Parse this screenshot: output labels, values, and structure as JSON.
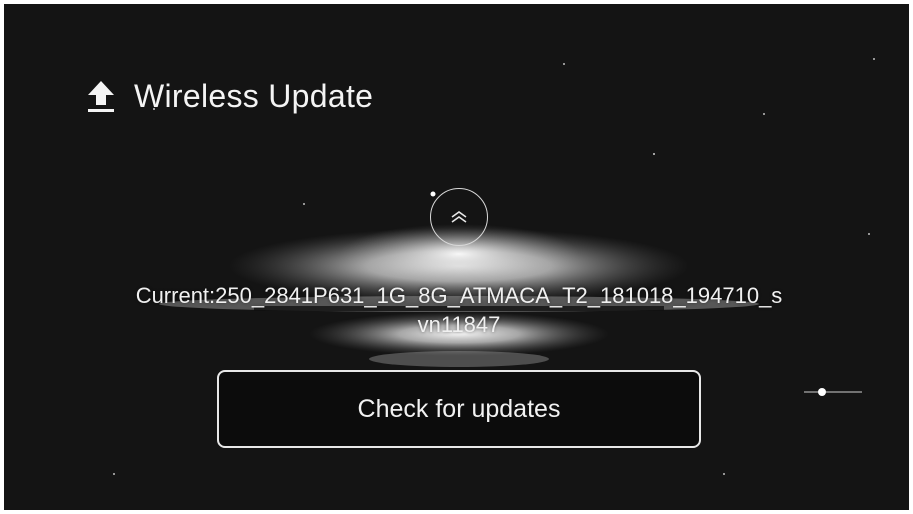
{
  "header": {
    "title": "Wireless Update",
    "icon": "upload-icon"
  },
  "scroll_up": {
    "icon": "double-chevron-up-icon"
  },
  "version": {
    "text": "Current:250_2841P631_1G_8G_ATMACA_T2_181018_194710_svn11847"
  },
  "actions": {
    "check_label": "Check for updates"
  },
  "colors": {
    "background": "#141414",
    "text": "#f2f2f2",
    "button_border": "#e8e8e8"
  }
}
